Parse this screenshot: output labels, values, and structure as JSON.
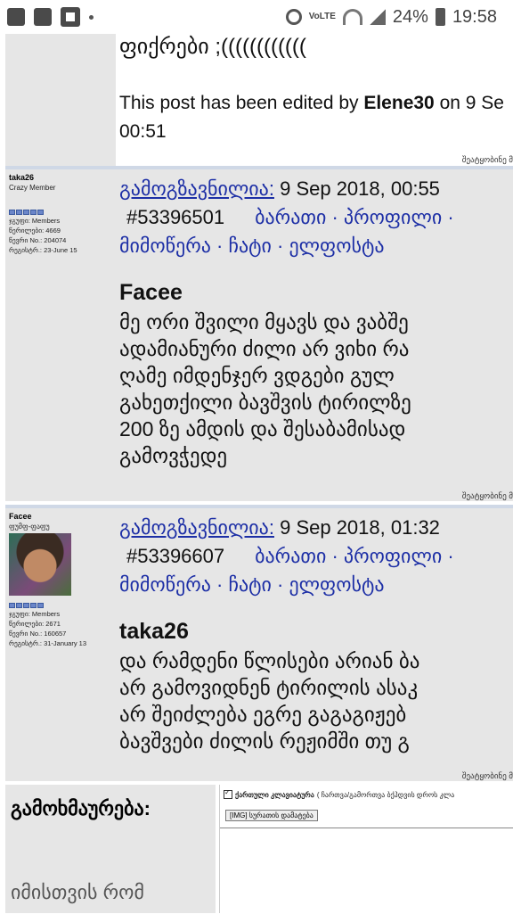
{
  "status_bar": {
    "battery": "24%",
    "time": "19:58",
    "network": "VoLTE"
  },
  "top_post": {
    "body_line": "ფიქრები ;((((((((((((",
    "edited_prefix": "This post has been edited by ",
    "edited_user": "Elene30",
    "edited_suffix": " on 9 Se",
    "edited_time": "00:51",
    "report": "შეატყობინე მ"
  },
  "posts": [
    {
      "author": "taka26",
      "rank": "Crazy Member",
      "group": "ჯგუფი: Members",
      "post_count": "წერილები: 4669",
      "member_no": "წევრი No.: 204074",
      "registered": "რეგისტრ.: 23-June 15",
      "posted_label": "გამოგზავნილია:",
      "posted_date": "9 Sep 2018, 00:55",
      "post_id": "#53396501",
      "links_line1": "ბარათი · პროფილი ·",
      "links_line2": "მიმოწერა · ჩატი · ელფოსტა",
      "quote_title": "Facee",
      "body_lines": [
        "მე ორი შვილი მყავს და ვაბშე",
        "ადამიანური ძილი არ ვიხი რა",
        "ღამე იმდენჯერ ვდგები გულ",
        "გახეთქილი ბავშვის ტირილზე",
        "200 ზე ამდის და შესაბამისად",
        "გამოვჭედე"
      ],
      "report": "შეატყობინე მ"
    },
    {
      "author": "Facee",
      "rank": "ფუმფ-ფაფუ",
      "group": "ჯგუფი: Members",
      "post_count": "წერილები: 2671",
      "member_no": "წევრი No.: 160657",
      "registered": "რეგისტრ.: 31-January 13",
      "posted_label": "გამოგზავნილია:",
      "posted_date": "9 Sep 2018, 01:32",
      "post_id": "#53396607",
      "links_line1": "ბარათი · პროფილი ·",
      "links_line2": "მიმოწერა · ჩატი · ელფოსტა",
      "quote_title": "taka26",
      "body_lines": [
        "და რამდენი წლისები არიან ბა",
        "არ გამოვიდნენ ტირილის ასაკ",
        "არ შეიძლება ეგრე გაგაგიჟებ",
        "ბავშვები ძილის რეჟიმში თუ გ"
      ],
      "report": "შეატყობინე მ"
    }
  ],
  "reply": {
    "label": "გამოხმაურება:",
    "hint": "იმისთვის რომ",
    "keyboard_label": "ქართული კლავიატურა",
    "keyboard_hint": "( ჩართვა/გამორთვა ბქჰდვის დროს კლა",
    "img_button": "[IMG] სურათის დამატება"
  }
}
